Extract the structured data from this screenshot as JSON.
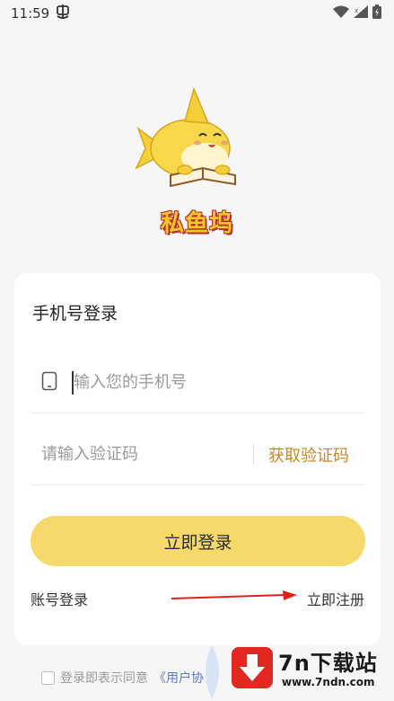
{
  "status_bar": {
    "time": "11:59",
    "notification_icon": "app-notification-icon",
    "wifi_icon": "wifi-icon",
    "signal_icon": "signal-icon",
    "battery_icon": "battery-icon"
  },
  "app": {
    "name": "私鱼坞",
    "logo_icon": "shark-reading-book-logo",
    "brand_color": "#f3c72b"
  },
  "login": {
    "title": "手机号登录",
    "phone_placeholder": "输入您的手机号",
    "code_placeholder": "请输入验证码",
    "get_code_label": "获取验证码",
    "submit_label": "立即登录",
    "account_login_label": "账号登录",
    "register_label": "立即注册",
    "button_color": "#f6d96a",
    "accent_color": "#c7872a"
  },
  "agreement": {
    "text": "登录即表示同意",
    "link": "《用户协"
  },
  "watermark": {
    "main": "7n下载站",
    "sub": "www.7ndn.com"
  }
}
